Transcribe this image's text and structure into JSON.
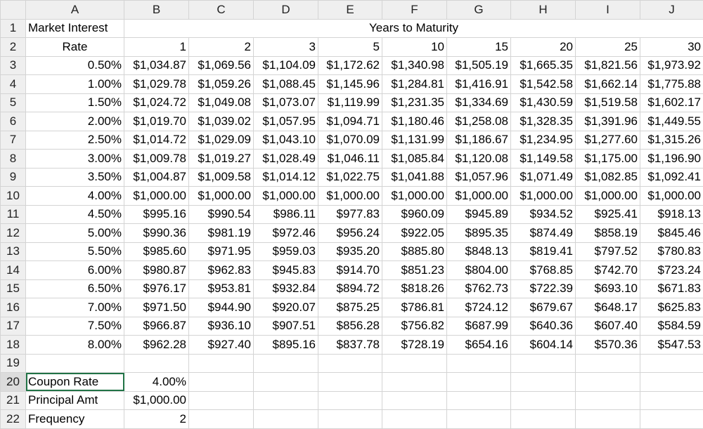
{
  "columns": [
    "A",
    "B",
    "C",
    "D",
    "E",
    "F",
    "G",
    "H",
    "I",
    "J"
  ],
  "header": {
    "r1_label": "Market Interest",
    "years_label": "Years to Maturity",
    "r2_label": "Rate",
    "years": [
      "1",
      "2",
      "3",
      "5",
      "10",
      "15",
      "20",
      "25",
      "30"
    ]
  },
  "rows": [
    {
      "rate": "0.50%",
      "v": [
        "$1,034.87",
        "$1,069.56",
        "$1,104.09",
        "$1,172.62",
        "$1,340.98",
        "$1,505.19",
        "$1,665.35",
        "$1,821.56",
        "$1,973.92"
      ]
    },
    {
      "rate": "1.00%",
      "v": [
        "$1,029.78",
        "$1,059.26",
        "$1,088.45",
        "$1,145.96",
        "$1,284.81",
        "$1,416.91",
        "$1,542.58",
        "$1,662.14",
        "$1,775.88"
      ]
    },
    {
      "rate": "1.50%",
      "v": [
        "$1,024.72",
        "$1,049.08",
        "$1,073.07",
        "$1,119.99",
        "$1,231.35",
        "$1,334.69",
        "$1,430.59",
        "$1,519.58",
        "$1,602.17"
      ]
    },
    {
      "rate": "2.00%",
      "v": [
        "$1,019.70",
        "$1,039.02",
        "$1,057.95",
        "$1,094.71",
        "$1,180.46",
        "$1,258.08",
        "$1,328.35",
        "$1,391.96",
        "$1,449.55"
      ]
    },
    {
      "rate": "2.50%",
      "v": [
        "$1,014.72",
        "$1,029.09",
        "$1,043.10",
        "$1,070.09",
        "$1,131.99",
        "$1,186.67",
        "$1,234.95",
        "$1,277.60",
        "$1,315.26"
      ]
    },
    {
      "rate": "3.00%",
      "v": [
        "$1,009.78",
        "$1,019.27",
        "$1,028.49",
        "$1,046.11",
        "$1,085.84",
        "$1,120.08",
        "$1,149.58",
        "$1,175.00",
        "$1,196.90"
      ]
    },
    {
      "rate": "3.50%",
      "v": [
        "$1,004.87",
        "$1,009.58",
        "$1,014.12",
        "$1,022.75",
        "$1,041.88",
        "$1,057.96",
        "$1,071.49",
        "$1,082.85",
        "$1,092.41"
      ]
    },
    {
      "rate": "4.00%",
      "v": [
        "$1,000.00",
        "$1,000.00",
        "$1,000.00",
        "$1,000.00",
        "$1,000.00",
        "$1,000.00",
        "$1,000.00",
        "$1,000.00",
        "$1,000.00"
      ]
    },
    {
      "rate": "4.50%",
      "v": [
        "$995.16",
        "$990.54",
        "$986.11",
        "$977.83",
        "$960.09",
        "$945.89",
        "$934.52",
        "$925.41",
        "$918.13"
      ]
    },
    {
      "rate": "5.00%",
      "v": [
        "$990.36",
        "$981.19",
        "$972.46",
        "$956.24",
        "$922.05",
        "$895.35",
        "$874.49",
        "$858.19",
        "$845.46"
      ]
    },
    {
      "rate": "5.50%",
      "v": [
        "$985.60",
        "$971.95",
        "$959.03",
        "$935.20",
        "$885.80",
        "$848.13",
        "$819.41",
        "$797.52",
        "$780.83"
      ]
    },
    {
      "rate": "6.00%",
      "v": [
        "$980.87",
        "$962.83",
        "$945.83",
        "$914.70",
        "$851.23",
        "$804.00",
        "$768.85",
        "$742.70",
        "$723.24"
      ]
    },
    {
      "rate": "6.50%",
      "v": [
        "$976.17",
        "$953.81",
        "$932.84",
        "$894.72",
        "$818.26",
        "$762.73",
        "$722.39",
        "$693.10",
        "$671.83"
      ]
    },
    {
      "rate": "7.00%",
      "v": [
        "$971.50",
        "$944.90",
        "$920.07",
        "$875.25",
        "$786.81",
        "$724.12",
        "$679.67",
        "$648.17",
        "$625.83"
      ]
    },
    {
      "rate": "7.50%",
      "v": [
        "$966.87",
        "$936.10",
        "$907.51",
        "$856.28",
        "$756.82",
        "$687.99",
        "$640.36",
        "$607.40",
        "$584.59"
      ]
    },
    {
      "rate": "8.00%",
      "v": [
        "$962.28",
        "$927.40",
        "$895.16",
        "$837.78",
        "$728.19",
        "$654.16",
        "$604.14",
        "$570.36",
        "$547.53"
      ]
    }
  ],
  "inputs": [
    {
      "label": "Coupon Rate",
      "value": "4.00%"
    },
    {
      "label": "Principal Amt",
      "value": "$1,000.00"
    },
    {
      "label": "Frequency",
      "value": "2"
    }
  ],
  "row_numbers": [
    "1",
    "2",
    "3",
    "4",
    "5",
    "6",
    "7",
    "8",
    "9",
    "10",
    "11",
    "12",
    "13",
    "14",
    "15",
    "16",
    "17",
    "18",
    "19",
    "20",
    "21",
    "22"
  ]
}
